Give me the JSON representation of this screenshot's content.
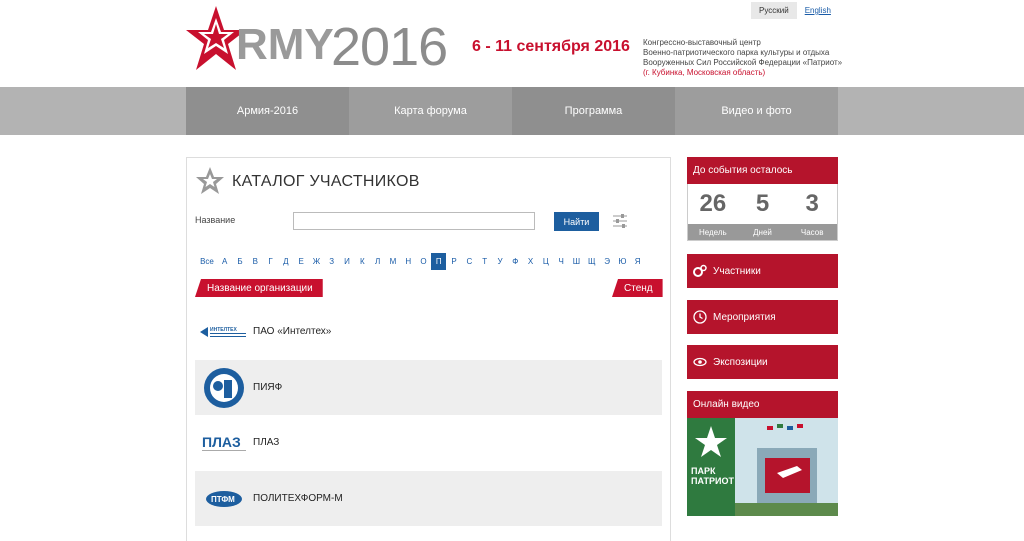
{
  "header": {
    "logo_army": "RMY",
    "logo_year": "2016",
    "dates": "6 - 11 сентября 2016",
    "venue_lines": [
      "Конгрессно-выставочный центр",
      "Военно-патриотического парка культуры и отдыха",
      "Вооруженных Сил Российской Федерации «Патриот»"
    ],
    "venue_location": "(г. Кубинка, Московская область)",
    "lang_ru": "Русский",
    "lang_en": "English"
  },
  "nav": {
    "items": [
      {
        "label": "Армия-2016"
      },
      {
        "label": "Карта форума"
      },
      {
        "label": "Программа"
      },
      {
        "label": "Видео и фото"
      }
    ]
  },
  "catalog": {
    "title": "КАТАЛОГ УЧАСТНИКОВ",
    "name_label": "Название",
    "search_value": "",
    "find_button": "Найти",
    "alphabet_all": "Все",
    "alphabet": [
      "А",
      "Б",
      "В",
      "Г",
      "Д",
      "Е",
      "Ж",
      "З",
      "И",
      "К",
      "Л",
      "М",
      "Н",
      "О",
      "П",
      "Р",
      "С",
      "Т",
      "У",
      "Ф",
      "Х",
      "Ц",
      "Ч",
      "Ш",
      "Щ",
      "Э",
      "Ю",
      "Я"
    ],
    "active_letter": "П",
    "col_org": "Название организации",
    "col_stand": "Стенд",
    "rows": [
      {
        "name": "ПАО «Интелтех»",
        "logo_text": "ИНТЕЛТЕХ"
      },
      {
        "name": "ПИЯФ",
        "logo_text": ""
      },
      {
        "name": "ПЛАЗ",
        "logo_text": "ПЛАЗ"
      },
      {
        "name": "ПОЛИТЕХФОРМ-М",
        "logo_text": "ПТФМ"
      }
    ]
  },
  "sidebar": {
    "countdown_title": "До события осталось",
    "countdown": [
      {
        "value": "26",
        "unit": "Недель"
      },
      {
        "value": "5",
        "unit": "Дней"
      },
      {
        "value": "3",
        "unit": "Часов"
      }
    ],
    "buttons": [
      {
        "label": "Участники",
        "icon": "gears-icon"
      },
      {
        "label": "Мероприятия",
        "icon": "clock-icon"
      },
      {
        "label": "Экспозиции",
        "icon": "eye-icon"
      }
    ],
    "video_title": "Онлайн видео",
    "video_park_text": "ПАРК",
    "video_patriot_text": "ПАТРИОТ"
  },
  "colors": {
    "brand_red": "#c8102e",
    "nav_gray": "#b3b3b3",
    "link_blue": "#1a5ca8",
    "button_blue": "#1d5e9f"
  }
}
